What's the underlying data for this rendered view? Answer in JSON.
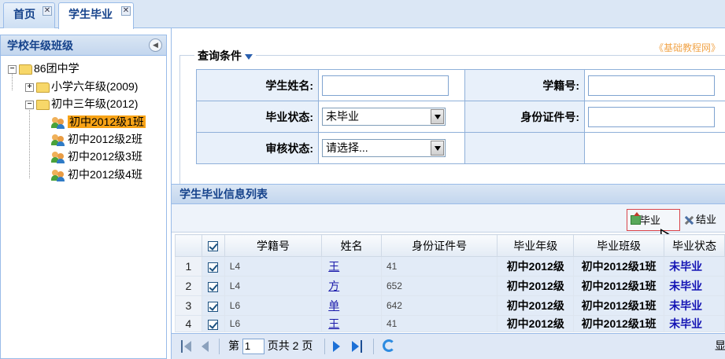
{
  "tabs": [
    {
      "label": "首页",
      "close": "✕"
    },
    {
      "label": "学生毕业",
      "close": "✕"
    }
  ],
  "tree": {
    "title": "学校年级班级",
    "collapse_glyph": "◀",
    "root": {
      "toggle": "−",
      "label": "86团中学"
    },
    "grades": [
      {
        "toggle": "+",
        "label": "小学六年级(2009)"
      },
      {
        "toggle": "−",
        "label": "初中三年级(2012)"
      }
    ],
    "classes": [
      {
        "label": "初中2012级1班",
        "selected": true
      },
      {
        "label": "初中2012级2班",
        "selected": false
      },
      {
        "label": "初中2012级3班",
        "selected": false
      },
      {
        "label": "初中2012级4班",
        "selected": false
      }
    ]
  },
  "top_link": "《基础教程网》",
  "query": {
    "legend": "查询条件",
    "labels": {
      "student_name": "学生姓名:",
      "student_id": "学籍号:",
      "grad_status": "毕业状态:",
      "id_card": "身份证件号:",
      "review_status": "审核状态:"
    },
    "grad_status_value": "未毕业",
    "review_status_value": "请选择..."
  },
  "list": {
    "title": "学生毕业信息列表",
    "buttons": {
      "graduate": "毕业",
      "conclude": "结业"
    },
    "columns": [
      "学籍号",
      "姓名",
      "身份证件号",
      "毕业年级",
      "毕业班级",
      "毕业状态"
    ],
    "rows": [
      {
        "no": "1",
        "id": "L4",
        "name": "王",
        "idcard": "41",
        "grade": "初中2012级",
        "class": "初中2012级1班",
        "status": "未毕业"
      },
      {
        "no": "2",
        "id": "L4",
        "name": "方",
        "idcard": "652",
        "grade": "初中2012级",
        "class": "初中2012级1班",
        "status": "未毕业"
      },
      {
        "no": "3",
        "id": "L6",
        "name": "单",
        "idcard": "642",
        "grade": "初中2012级",
        "class": "初中2012级1班",
        "status": "未毕业"
      },
      {
        "no": "4",
        "id": "L6",
        "name": "王",
        "idcard": "41",
        "grade": "初中2012级",
        "class": "初中2012级1班",
        "status": "未毕业"
      }
    ]
  },
  "pager": {
    "before": "第",
    "page": "1",
    "after": "页共 2 页",
    "right": "显"
  }
}
